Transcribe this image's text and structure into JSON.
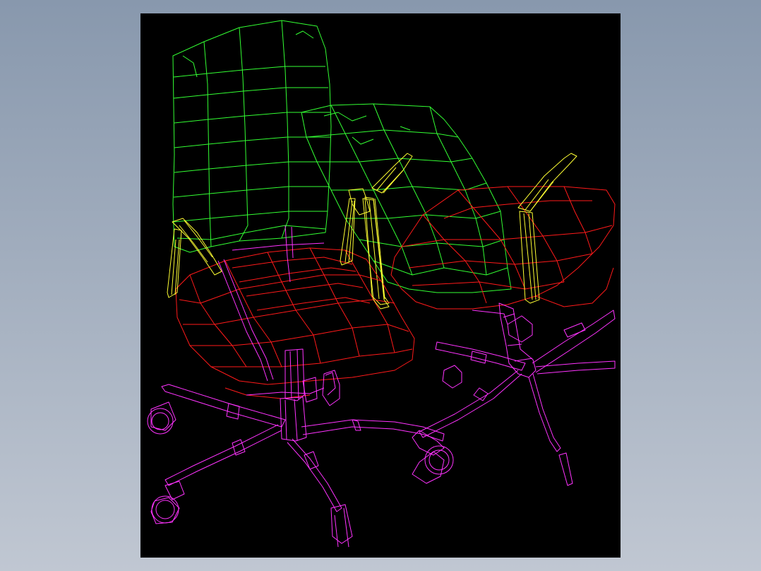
{
  "scene": {
    "background": "#000000",
    "backdrop_top": "#8898ad",
    "backdrop_bottom": "#c0c7d2",
    "layers": {
      "backrest": "#33ff33",
      "seat": "#ff1a1a",
      "armrest": "#ffff33",
      "base": "#ff33ff"
    },
    "objects": [
      "front-office-chair",
      "rear-office-chair"
    ]
  }
}
